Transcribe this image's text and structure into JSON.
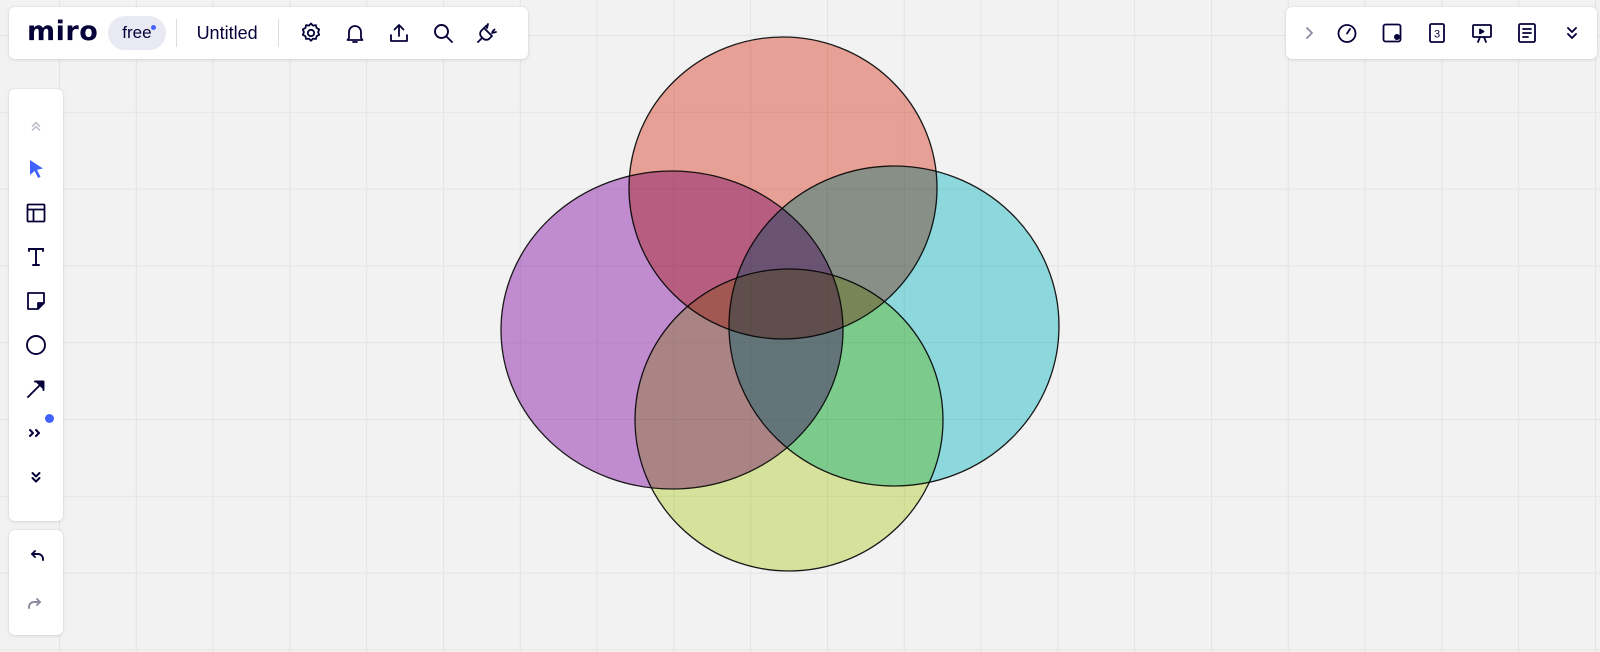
{
  "app": {
    "logo_text": "miro",
    "plan_badge": "free",
    "board_title": "Untitled"
  },
  "top_left_toolbar": {
    "icons": [
      "settings-icon",
      "notifications-bell-icon",
      "upload-icon",
      "search-icon",
      "plug-icon"
    ]
  },
  "top_right_toolbar": {
    "icons": [
      "chevron-right-icon",
      "timer-icon",
      "card-with-dot-icon",
      "count-badge-icon",
      "presentation-icon",
      "notes-icon",
      "double-chevron-down-icon"
    ],
    "count_badge_text": "3"
  },
  "left_toolbar": {
    "tools": [
      "collapse-up-icon",
      "select-cursor-icon",
      "template-layout-icon",
      "text-tool-icon",
      "sticky-note-icon",
      "shape-circle-icon",
      "arrow-connector-icon",
      "more-tools-icon",
      "expand-down-icon"
    ],
    "active_tool": "select-cursor-icon",
    "accent_color": "#4262ff"
  },
  "history": {
    "undo_icon": "undo-icon",
    "redo_icon": "redo-icon"
  },
  "canvas": {
    "background_color": "#f2f2f2",
    "grid": true,
    "shapes": [
      {
        "name": "top-circle",
        "fill": "#f3a092"
      },
      {
        "name": "left-circle",
        "fill": "#c588d6"
      },
      {
        "name": "right-circle",
        "fill": "#89e1e6"
      },
      {
        "name": "bottom-circle",
        "fill": "#dfed9a"
      }
    ]
  }
}
